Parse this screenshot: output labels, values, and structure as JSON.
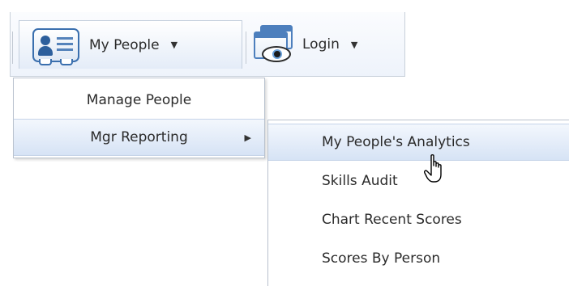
{
  "toolbar": {
    "my_people": {
      "label": "My People",
      "icon": "people-card-icon",
      "caret": "▼"
    },
    "login": {
      "label": "Login",
      "icon": "login-window-eye-icon",
      "caret": "▼"
    }
  },
  "people_menu": {
    "items": [
      {
        "label": "Manage People"
      },
      {
        "label": "Mgr Reporting",
        "submenu_arrow": "▶"
      }
    ]
  },
  "reporting_submenu": {
    "items": [
      {
        "label": "My People's Analytics"
      },
      {
        "label": "Skills Audit"
      },
      {
        "label": "Chart Recent Scores"
      },
      {
        "label": "Scores By Person"
      }
    ]
  },
  "colors": {
    "highlight": "#d6e3f5",
    "icon_blue": "#3a6fae",
    "border": "#b9c2ce"
  }
}
